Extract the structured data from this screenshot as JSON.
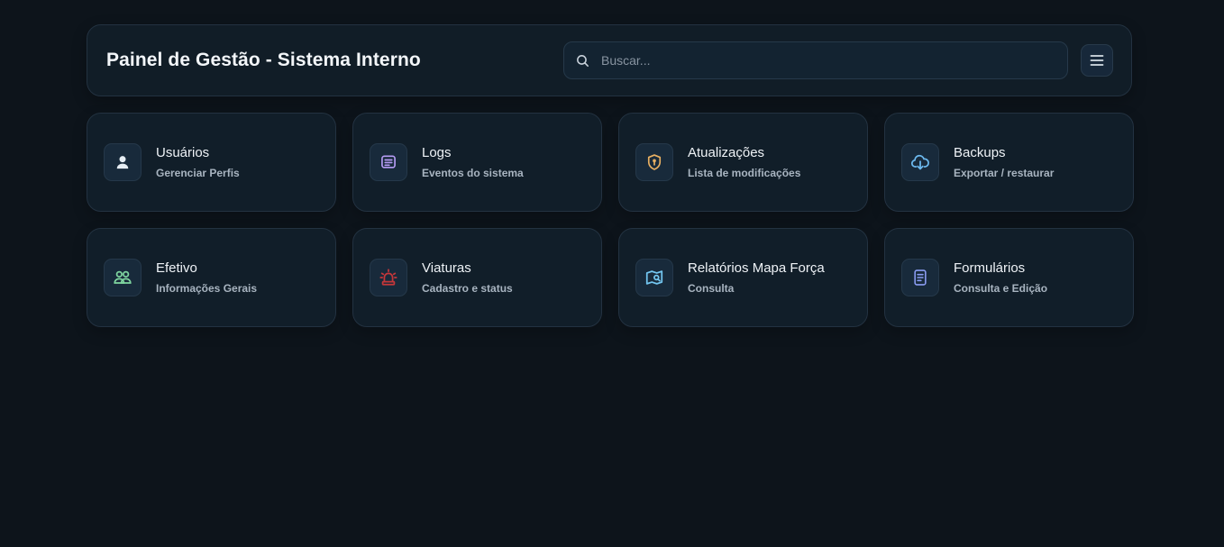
{
  "header": {
    "title": "Painel de Gestão - Sistema Interno",
    "search_placeholder": "Buscar...",
    "menu_icon": "hamburger-menu-icon"
  },
  "cards": [
    {
      "title": "Usuários",
      "subtitle": "Gerenciar Perfis",
      "icon": "user-icon",
      "icon_color": "#e6edf3"
    },
    {
      "title": "Logs",
      "subtitle": "Eventos do sistema",
      "icon": "log-list-icon",
      "icon_color": "#b69cf5"
    },
    {
      "title": "Atualizações",
      "subtitle": "Lista de modificações",
      "icon": "shield-icon",
      "icon_color": "#e9b062"
    },
    {
      "title": "Backups",
      "subtitle": "Exportar / restaurar",
      "icon": "cloud-download-icon",
      "icon_color": "#6cb9ef"
    },
    {
      "title": "Efetivo",
      "subtitle": "Informações Gerais",
      "icon": "people-icon",
      "icon_color": "#7fd6a0"
    },
    {
      "title": "Viaturas",
      "subtitle": "Cadastro e status",
      "icon": "siren-icon",
      "icon_color": "#c4373a"
    },
    {
      "title": "Relatórios Mapa Força",
      "subtitle": "Consulta",
      "icon": "map-report-icon",
      "icon_color": "#73c6f0"
    },
    {
      "title": "Formulários",
      "subtitle": "Consulta e Edição",
      "icon": "document-icon",
      "icon_color": "#8a9cf2"
    }
  ]
}
